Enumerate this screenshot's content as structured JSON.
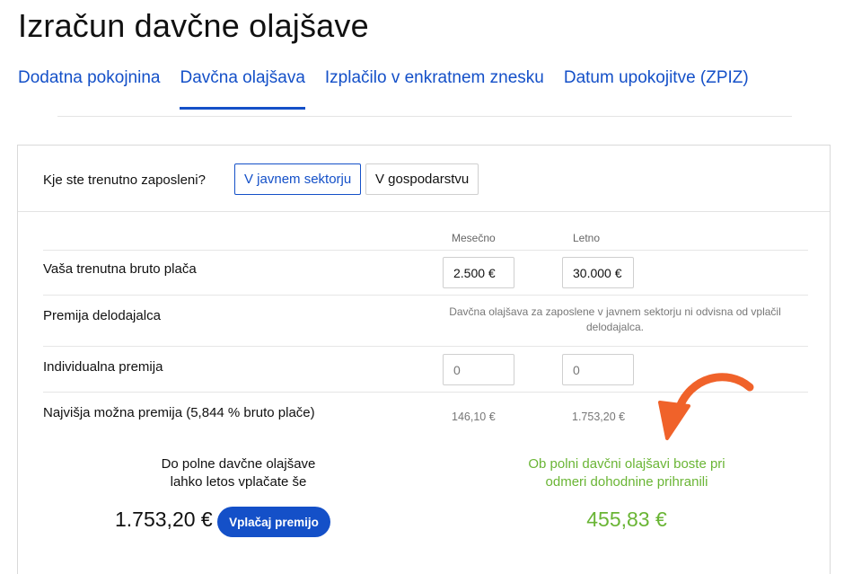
{
  "page": {
    "title": "Izračun davčne olajšave"
  },
  "tabs": [
    {
      "label": "Dodatna pokojnina"
    },
    {
      "label": "Davčna olajšava"
    },
    {
      "label": "Izplačilo v enkratnem znesku"
    },
    {
      "label": "Datum upokojitve (ZPIZ)"
    }
  ],
  "active_tab": 1,
  "sector": {
    "question": "Kje ste trenutno zaposleni?",
    "options": [
      {
        "label": "V javnem sektorju"
      },
      {
        "label": "V gospodarstvu"
      }
    ],
    "selected": 0
  },
  "columns": {
    "monthly": "Mesečno",
    "yearly": "Letno"
  },
  "rows": {
    "salary": {
      "label": "Vaša trenutna bruto plača",
      "monthly": "2.500 €",
      "yearly": "30.000 €"
    },
    "employer_premium": {
      "label": "Premija delodajalca",
      "note": "Davčna olajšava za zaposlene v javnem sektorju ni odvisna od vplačil delodajalca."
    },
    "individual_premium": {
      "label": "Individualna premija",
      "monthly": "0",
      "yearly": "0"
    },
    "max_premium": {
      "label": "Najvišja možna premija (5,844 % bruto plače)",
      "monthly": "146,10 €",
      "yearly": "1.753,20 €"
    }
  },
  "summary_left": {
    "line1": "Do polne davčne olajšave",
    "line2": "lahko letos vplačate še",
    "amount": "1.753,20 €",
    "button": "Vplačaj premijo"
  },
  "summary_right": {
    "line1": "Ob polni davčni olajšavi boste pri",
    "line2": "odmeri dohodnine prihranili",
    "amount": "455,83 €"
  },
  "colors": {
    "accent": "#1450c8",
    "savings": "#6ab535",
    "arrow": "#f0622a"
  },
  "icons": {
    "arrow": "curved-arrow-icon"
  }
}
